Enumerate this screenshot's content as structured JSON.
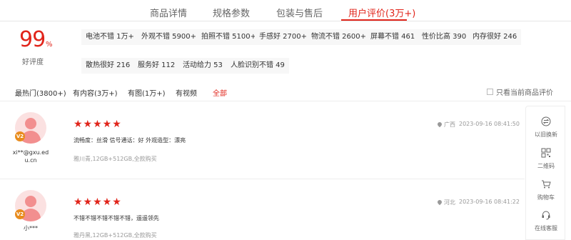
{
  "tabs": [
    "商品详情",
    "规格参数",
    "包装与售后",
    "用户评价(3万+)"
  ],
  "rating": {
    "percent": "99",
    "percent_sign": "%",
    "label": "好评度"
  },
  "tags": [
    "电池不错 1万+",
    "外观不错 5900+",
    "拍照不错 5100+",
    "手感好 2700+",
    "物流不错 2600+",
    "屏幕不错 461",
    "性价比高 390",
    "内存很好 246",
    "散热很好 216",
    "服务好 112",
    "活动给力 53",
    "人脸识别不错 49"
  ],
  "filters": [
    "最热门(3800+)",
    "有内容(3万+)",
    "有图(1万+)",
    "有视频",
    "全部"
  ],
  "only_current_label": "只看当前商品评价",
  "reviews": [
    {
      "vip": "V2",
      "username_line1": "xi**@gxu.ed",
      "username_line2": "u.cn",
      "stars": "★★★★★",
      "location": "广西",
      "time": "2023-09-16 08:41:50",
      "content": "流畅度：丝滑 信号通话：好 外观造型：漂亮",
      "spec": "雅川青,12GB+512GB,全款购买"
    },
    {
      "vip": "V2",
      "username_line1": "小***",
      "username_line2": "",
      "stars": "★★★★★",
      "location": "河北",
      "time": "2023-09-16 08:41:22",
      "content": "不错不错不错不错不错，遥遥领先",
      "spec": "雅丹黑,12GB+512GB,全款购买"
    }
  ],
  "toolbar": [
    "以旧换新",
    "二维码",
    "购物车",
    "在线客服"
  ],
  "colors": {
    "accent": "#e1251b",
    "vip": "#e88c1e"
  }
}
